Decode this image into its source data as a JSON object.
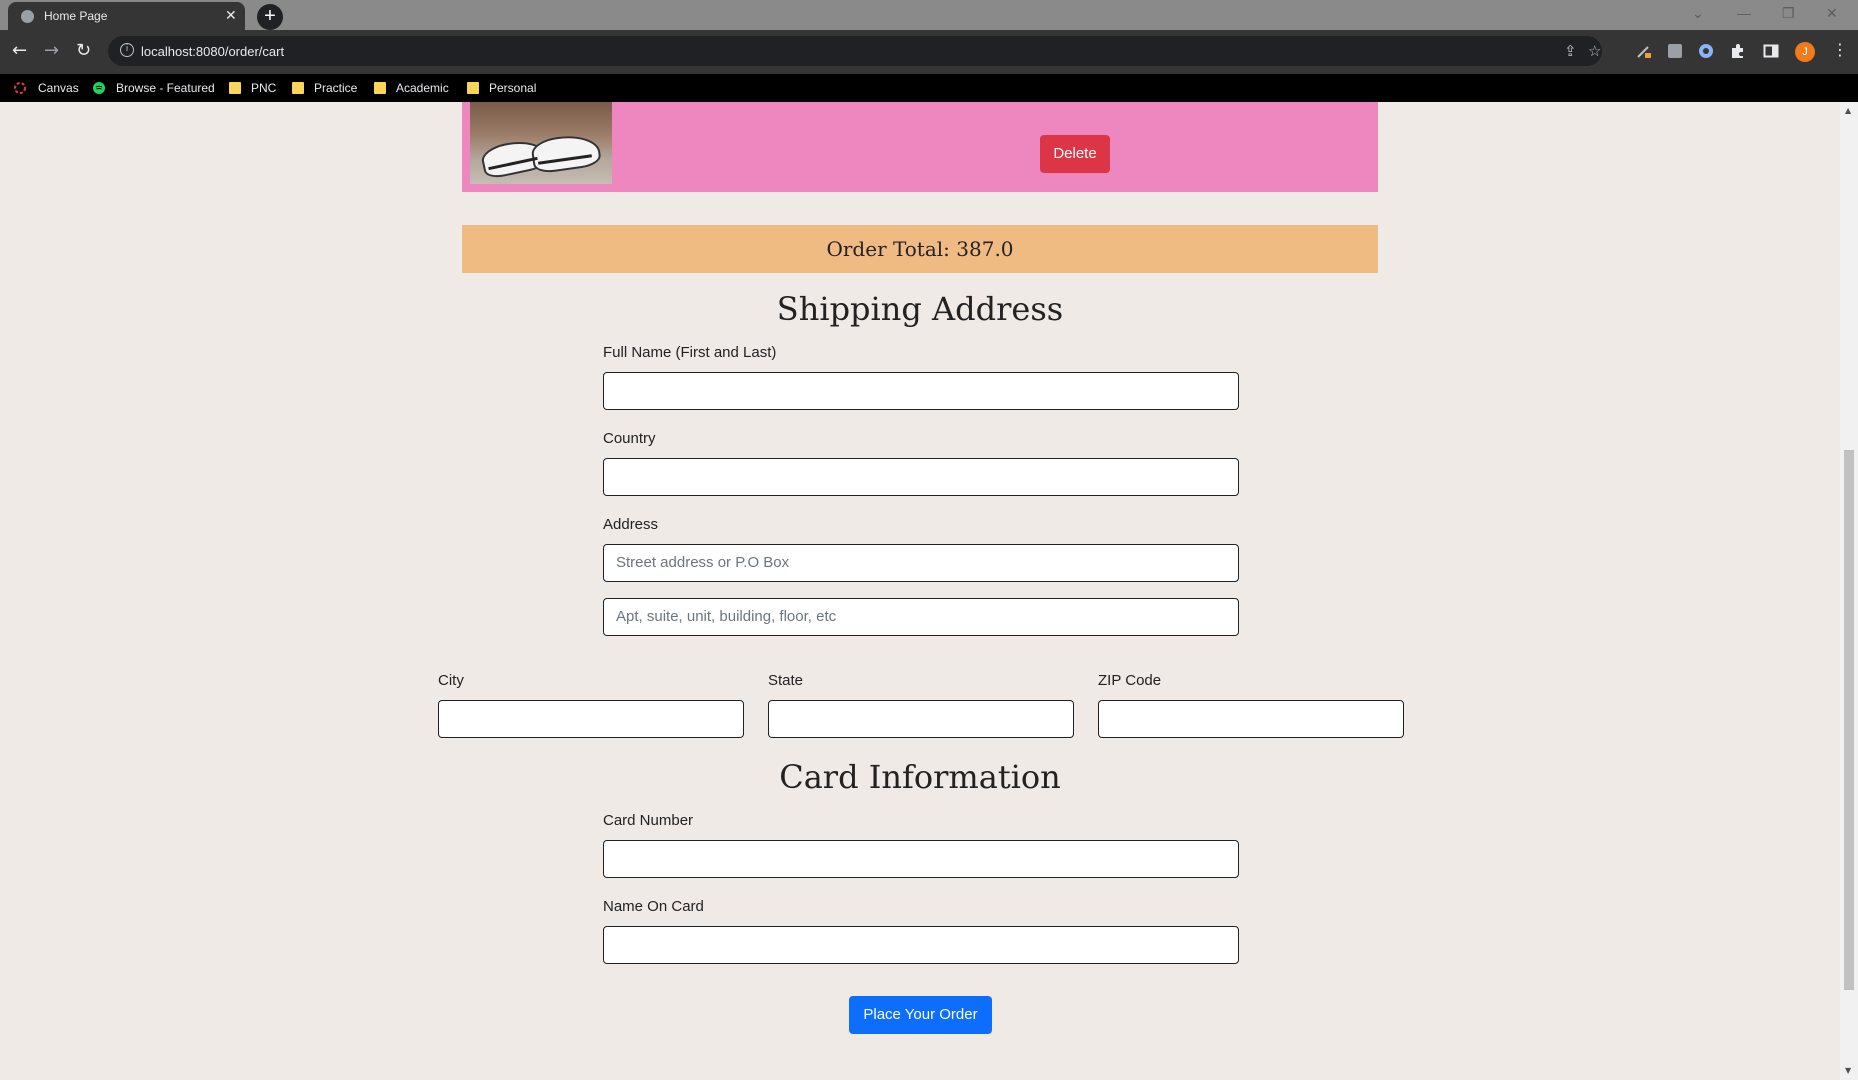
{
  "browser": {
    "tab_title": "Home Page",
    "tab_close": "✕",
    "new_tab": "+",
    "url": "localhost:8080/order/cart",
    "avatar_initial": "J",
    "bookmarks": [
      "Canvas",
      "Browse - Featured",
      "PNC",
      "Practice",
      "Academic",
      "Personal"
    ]
  },
  "cart": {
    "delete_label": "Delete",
    "order_total": "Order Total: 387.0"
  },
  "shipping": {
    "title": "Shipping Address",
    "full_name_label": "Full Name (First and Last)",
    "country_label": "Country",
    "address_label": "Address",
    "address1_placeholder": "Street address or P.O Box",
    "address2_placeholder": "Apt, suite, unit, building, floor, etc",
    "city_label": "City",
    "state_label": "State",
    "zip_label": "ZIP Code"
  },
  "card": {
    "title": "Card Information",
    "number_label": "Card Number",
    "name_label": "Name On Card"
  },
  "actions": {
    "place_order": "Place Your Order"
  },
  "colors": {
    "item_bg": "#ee86bf",
    "total_bg": "#f0bb83",
    "delete": "#dc3545",
    "primary": "#0d6efd",
    "page_bg": "#efeae6"
  }
}
